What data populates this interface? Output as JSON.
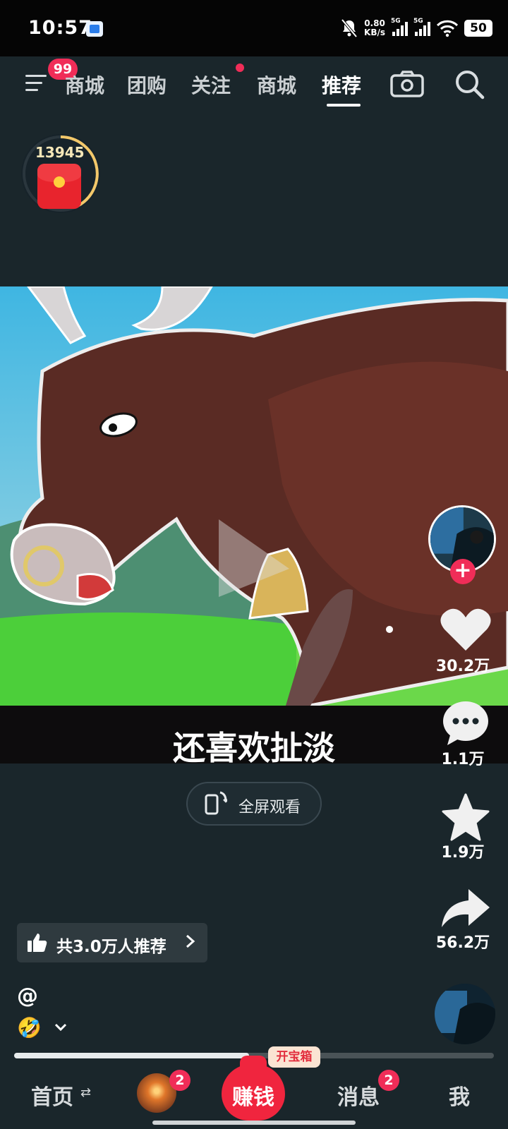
{
  "status_bar": {
    "time": "10:57",
    "speed_value": "0.80",
    "speed_unit": "KB/s",
    "sim1_tag": "5G",
    "sim2_tag": "5G",
    "battery": "50"
  },
  "top_nav": {
    "menu_badge": "99",
    "tabs": [
      {
        "label": "商城",
        "active": false
      },
      {
        "label": "团购",
        "active": false
      },
      {
        "label": "关注",
        "active": false
      },
      {
        "label": "商城",
        "active": false
      },
      {
        "label": "推荐",
        "active": true
      }
    ],
    "icons": [
      "menu-icon",
      "camera-icon",
      "search-icon"
    ]
  },
  "red_packet": {
    "count": "13945"
  },
  "video": {
    "caption": "还喜欢扯淡",
    "fullscreen_label": "全屏观看"
  },
  "actions": {
    "like_count": "30.2万",
    "comment_count": "1.1万",
    "favorite_count": "1.9万",
    "share_count": "56.2万",
    "follow_plus": "+"
  },
  "recommend": {
    "label": "共3.0万人推荐"
  },
  "post": {
    "handle": "@",
    "emoji": "🤣"
  },
  "progress": {
    "fraction": 0.49,
    "chest_label": "开宝箱"
  },
  "bottom_nav": {
    "home": "首页",
    "home_swap": "⇄",
    "live_badge": "2",
    "earn": "赚钱",
    "messages": "消息",
    "messages_badge": "2",
    "me": "我"
  },
  "colors": {
    "background": "#1a262b",
    "accent": "#f02d58",
    "earn_red": "#f0253e"
  }
}
